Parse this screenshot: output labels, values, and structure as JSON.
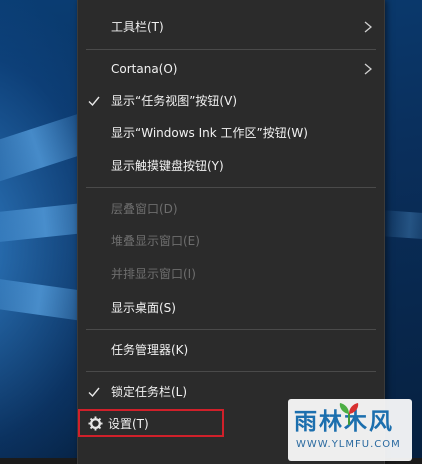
{
  "context_menu": {
    "items": [
      {
        "label": "工具栏(T)",
        "has_submenu": true,
        "checked": false,
        "enabled": true
      },
      {
        "label": "Cortana(O)",
        "has_submenu": true,
        "checked": false,
        "enabled": true
      },
      {
        "label": "显示“任务视图”按钮(V)",
        "has_submenu": false,
        "checked": true,
        "enabled": true
      },
      {
        "label": "显示“Windows Ink 工作区”按钮(W)",
        "has_submenu": false,
        "checked": false,
        "enabled": true
      },
      {
        "label": "显示触摸键盘按钮(Y)",
        "has_submenu": false,
        "checked": false,
        "enabled": true
      },
      {
        "label": "层叠窗口(D)",
        "has_submenu": false,
        "checked": false,
        "enabled": false
      },
      {
        "label": "堆叠显示窗口(E)",
        "has_submenu": false,
        "checked": false,
        "enabled": false
      },
      {
        "label": "并排显示窗口(I)",
        "has_submenu": false,
        "checked": false,
        "enabled": false
      },
      {
        "label": "显示桌面(S)",
        "has_submenu": false,
        "checked": false,
        "enabled": true
      },
      {
        "label": "任务管理器(K)",
        "has_submenu": false,
        "checked": false,
        "enabled": true
      },
      {
        "label": "锁定任务栏(L)",
        "has_submenu": false,
        "checked": true,
        "enabled": true
      },
      {
        "label": "设置(T)",
        "has_submenu": false,
        "checked": false,
        "enabled": true,
        "icon": "gear-icon",
        "highlighted": true
      }
    ]
  },
  "watermark": {
    "title": "雨林木风",
    "url": "WWW.YLMFU.COM"
  },
  "colors": {
    "menu_bg": "#2b2b2b",
    "menu_text": "#f2f2f2",
    "disabled_text": "#6e6e6e",
    "highlight_border": "#d0202a"
  }
}
